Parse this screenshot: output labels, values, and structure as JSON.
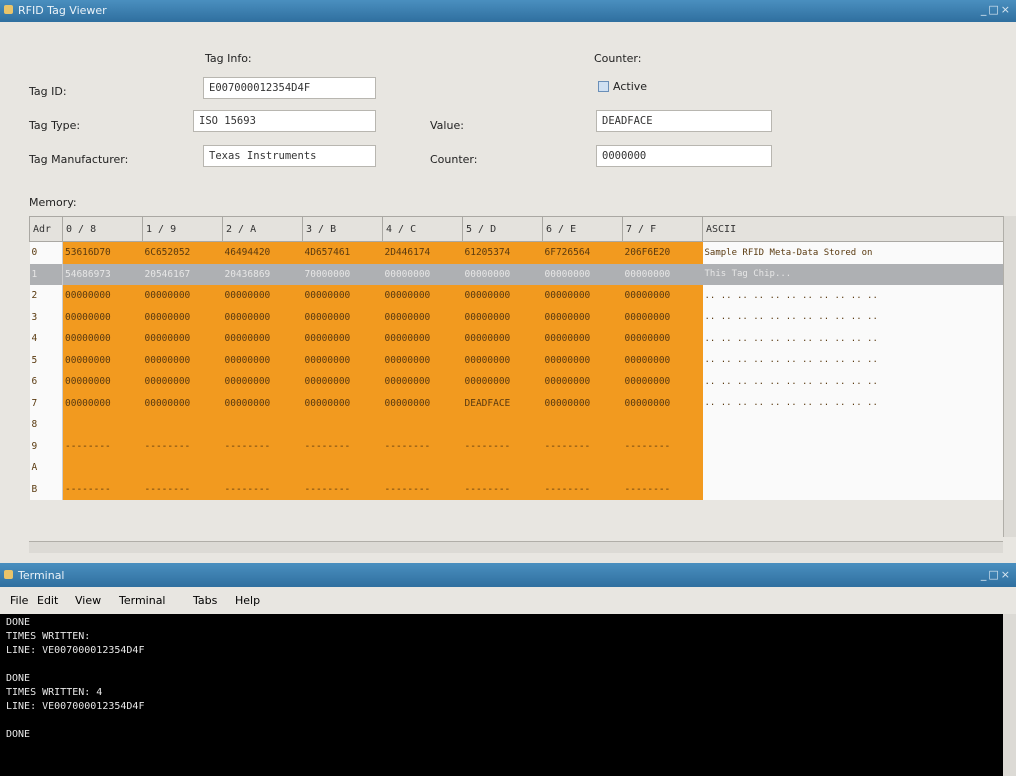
{
  "app": {
    "title": "RFID Tag Viewer",
    "window_buttons": "_□×"
  },
  "tag_info": {
    "heading": "Tag Info:",
    "tag_id_label": "Tag ID:",
    "tag_id_value": "E007000012354D4F",
    "tag_type_label": "Tag Type:",
    "tag_type_value": "ISO 15693",
    "tag_manufacturer_label": "Tag Manufacturer:",
    "tag_manufacturer_value": "Texas Instruments"
  },
  "counter": {
    "heading": "Counter:",
    "active_label": "Active",
    "value_label": "Value:",
    "value_value": "DEADFACE",
    "counter_label": "Counter:",
    "counter_value": "0000000"
  },
  "memory": {
    "label": "Memory:",
    "columns": [
      "Adr",
      "0 / 8",
      "1 / 9",
      "2 / A",
      "3 / B",
      "4 / C",
      "5 / D",
      "6 / E",
      "7 / F",
      "ASCII"
    ],
    "rows": [
      {
        "addr": "0",
        "cells": [
          "53616D70",
          "6C652052",
          "46494420",
          "4D657461",
          "2D446174",
          "61205374",
          "6F726564",
          "206F6E20"
        ],
        "ascii": "Sample RFID Meta-Data Stored on"
      },
      {
        "addr": "1",
        "cells": [
          "54686973",
          "20546167",
          "20436869",
          "70000000",
          "00000000",
          "00000000",
          "00000000",
          "00000000"
        ],
        "ascii": "This Tag Chip..."
      },
      {
        "addr": "2",
        "cells": [
          "00000000",
          "00000000",
          "00000000",
          "00000000",
          "00000000",
          "00000000",
          "00000000",
          "00000000"
        ],
        "ascii": ".. .. .. .. .. .. .. .. .. .. .."
      },
      {
        "addr": "3",
        "cells": [
          "00000000",
          "00000000",
          "00000000",
          "00000000",
          "00000000",
          "00000000",
          "00000000",
          "00000000"
        ],
        "ascii": ".. .. .. .. .. .. .. .. .. .. .."
      },
      {
        "addr": "4",
        "cells": [
          "00000000",
          "00000000",
          "00000000",
          "00000000",
          "00000000",
          "00000000",
          "00000000",
          "00000000"
        ],
        "ascii": ".. .. .. .. .. .. .. .. .. .. .."
      },
      {
        "addr": "5",
        "cells": [
          "00000000",
          "00000000",
          "00000000",
          "00000000",
          "00000000",
          "00000000",
          "00000000",
          "00000000"
        ],
        "ascii": ".. .. .. .. .. .. .. .. .. .. .."
      },
      {
        "addr": "6",
        "cells": [
          "00000000",
          "00000000",
          "00000000",
          "00000000",
          "00000000",
          "00000000",
          "00000000",
          "00000000"
        ],
        "ascii": ".. .. .. .. .. .. .. .. .. .. .."
      },
      {
        "addr": "7",
        "cells": [
          "00000000",
          "00000000",
          "00000000",
          "00000000",
          "00000000",
          "DEADFACE",
          "00000000",
          "00000000"
        ],
        "ascii": ".. .. .. .. .. .. .. .. .. .. .."
      },
      {
        "addr": "8",
        "cells": [
          "",
          "",
          "",
          "",
          "",
          "",
          "",
          ""
        ],
        "ascii": ""
      },
      {
        "addr": "9",
        "cells": [
          "--------",
          "--------",
          "--------",
          "--------",
          "--------",
          "--------",
          "--------",
          "--------"
        ],
        "ascii": ""
      },
      {
        "addr": "A",
        "cells": [
          "",
          "",
          "",
          "",
          "",
          "",
          "",
          ""
        ],
        "ascii": ""
      },
      {
        "addr": "B",
        "cells": [
          "--------",
          "--------",
          "--------",
          "--------",
          "--------",
          "--------",
          "--------",
          "--------"
        ],
        "ascii": ""
      }
    ]
  },
  "terminal": {
    "title": "Terminal",
    "menu": [
      "File",
      "Edit",
      "View",
      "Terminal",
      "Tabs",
      "Help"
    ],
    "text": "DONE\nTIMES WRITTEN:\nLINE: VE007000012354D4F\n\nDONE\nTIMES WRITTEN: 4\nLINE: VE007000012354D4F\n\nDONE"
  },
  "colors": {
    "hex_bg": "#f29a1f",
    "title_bar": "#3a7cab",
    "selected_row": "#aeb0b3"
  }
}
